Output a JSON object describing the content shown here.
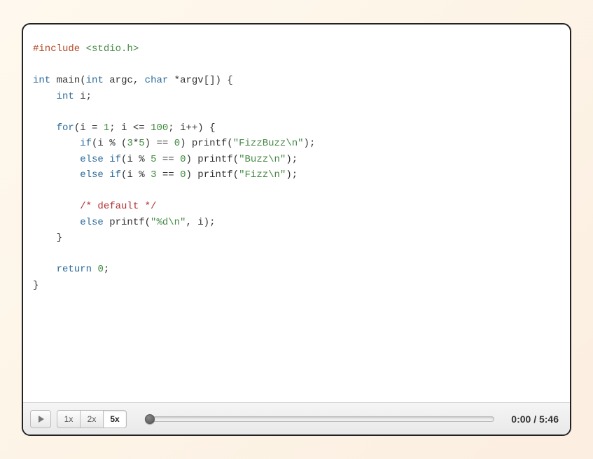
{
  "playback": {
    "current_time": "0:00",
    "total_time": "5:46",
    "time_display": "0:00 / 5:46",
    "speeds": [
      "1x",
      "2x",
      "5x"
    ],
    "active_speed_index": 2,
    "progress_pct": 0
  },
  "code": {
    "language": "c",
    "tokens": [
      [
        {
          "t": "#include ",
          "c": "pp"
        },
        {
          "t": "<stdio.h>",
          "c": "str"
        }
      ],
      [],
      [
        {
          "t": "int",
          "c": "type"
        },
        {
          "t": " main(",
          "c": ""
        },
        {
          "t": "int",
          "c": "type"
        },
        {
          "t": " argc, ",
          "c": ""
        },
        {
          "t": "char",
          "c": "type"
        },
        {
          "t": " *argv[]) {",
          "c": ""
        }
      ],
      [
        {
          "t": "    ",
          "c": ""
        },
        {
          "t": "int",
          "c": "type"
        },
        {
          "t": " i;",
          "c": ""
        }
      ],
      [],
      [
        {
          "t": "    ",
          "c": ""
        },
        {
          "t": "for",
          "c": "kw"
        },
        {
          "t": "(i = ",
          "c": ""
        },
        {
          "t": "1",
          "c": "num"
        },
        {
          "t": "; i <= ",
          "c": ""
        },
        {
          "t": "100",
          "c": "num"
        },
        {
          "t": "; i++) {",
          "c": ""
        }
      ],
      [
        {
          "t": "        ",
          "c": ""
        },
        {
          "t": "if",
          "c": "kw"
        },
        {
          "t": "(i % (",
          "c": ""
        },
        {
          "t": "3",
          "c": "num"
        },
        {
          "t": "*",
          "c": ""
        },
        {
          "t": "5",
          "c": "num"
        },
        {
          "t": ") == ",
          "c": ""
        },
        {
          "t": "0",
          "c": "num"
        },
        {
          "t": ") printf(",
          "c": ""
        },
        {
          "t": "\"FizzBuzz\\n\"",
          "c": "str"
        },
        {
          "t": ");",
          "c": ""
        }
      ],
      [
        {
          "t": "        ",
          "c": ""
        },
        {
          "t": "else",
          "c": "kw"
        },
        {
          "t": " ",
          "c": ""
        },
        {
          "t": "if",
          "c": "kw"
        },
        {
          "t": "(i % ",
          "c": ""
        },
        {
          "t": "5",
          "c": "num"
        },
        {
          "t": " == ",
          "c": ""
        },
        {
          "t": "0",
          "c": "num"
        },
        {
          "t": ") printf(",
          "c": ""
        },
        {
          "t": "\"Buzz\\n\"",
          "c": "str"
        },
        {
          "t": ");",
          "c": ""
        }
      ],
      [
        {
          "t": "        ",
          "c": ""
        },
        {
          "t": "else",
          "c": "kw"
        },
        {
          "t": " ",
          "c": ""
        },
        {
          "t": "if",
          "c": "kw"
        },
        {
          "t": "(i % ",
          "c": ""
        },
        {
          "t": "3",
          "c": "num"
        },
        {
          "t": " == ",
          "c": ""
        },
        {
          "t": "0",
          "c": "num"
        },
        {
          "t": ") printf(",
          "c": ""
        },
        {
          "t": "\"Fizz\\n\"",
          "c": "str"
        },
        {
          "t": ");",
          "c": ""
        }
      ],
      [],
      [
        {
          "t": "        ",
          "c": ""
        },
        {
          "t": "/* default */",
          "c": "cmt"
        }
      ],
      [
        {
          "t": "        ",
          "c": ""
        },
        {
          "t": "else",
          "c": "kw"
        },
        {
          "t": " printf(",
          "c": ""
        },
        {
          "t": "\"%d\\n\"",
          "c": "str"
        },
        {
          "t": ", i);",
          "c": ""
        }
      ],
      [
        {
          "t": "    }",
          "c": ""
        }
      ],
      [],
      [
        {
          "t": "    ",
          "c": ""
        },
        {
          "t": "return",
          "c": "kw"
        },
        {
          "t": " ",
          "c": ""
        },
        {
          "t": "0",
          "c": "num"
        },
        {
          "t": ";",
          "c": ""
        }
      ],
      [
        {
          "t": "}",
          "c": ""
        }
      ]
    ]
  }
}
